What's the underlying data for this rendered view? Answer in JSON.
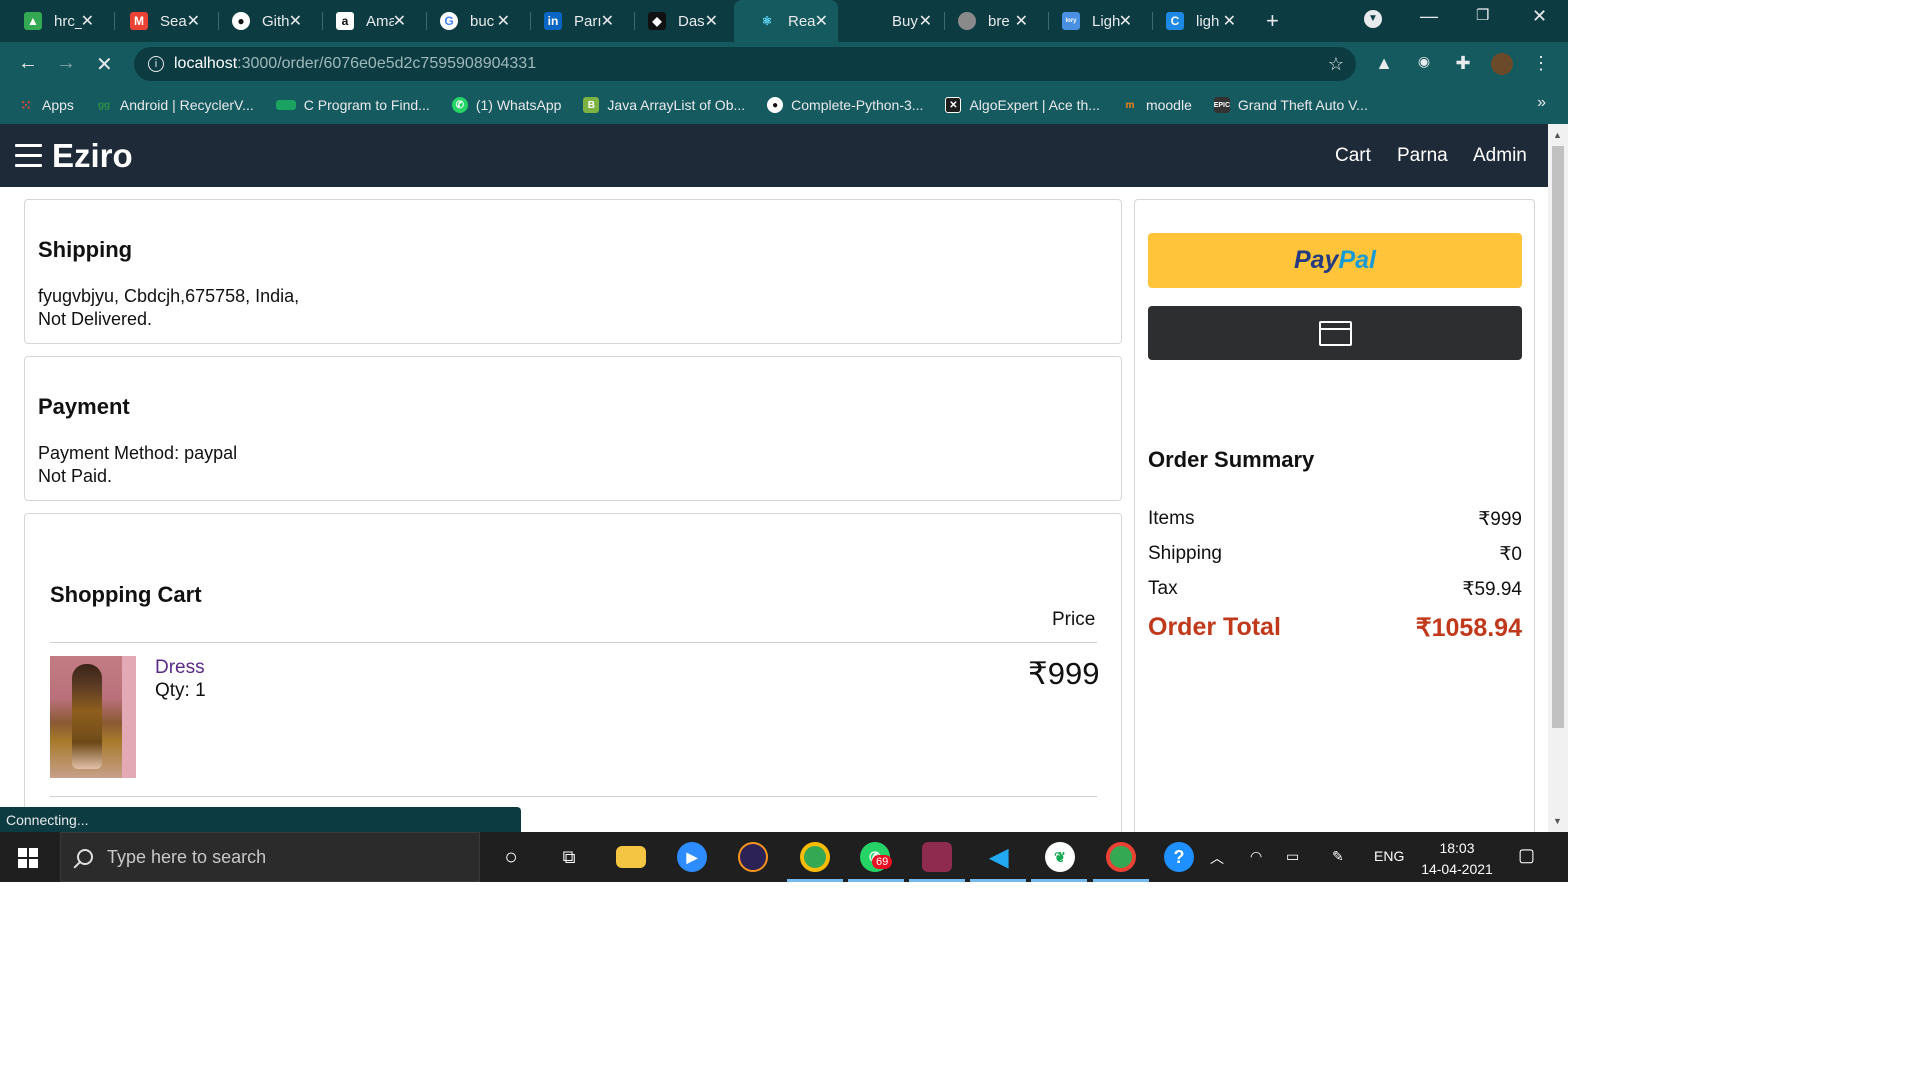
{
  "browser": {
    "tabs": [
      {
        "label": "hrc_",
        "icon": "google-drive-icon",
        "color": "#34a853"
      },
      {
        "label": "Sea",
        "icon": "gmail-icon",
        "color": "#ea4335"
      },
      {
        "label": "Gith",
        "icon": "github-icon",
        "color": "#ffffff"
      },
      {
        "label": "Ama",
        "icon": "amazon-icon",
        "color": "#ffffff"
      },
      {
        "label": "buc",
        "icon": "google-icon",
        "color": "#4285f4"
      },
      {
        "label": "Parı",
        "icon": "linkedin-icon",
        "color": "#0a66c2"
      },
      {
        "label": "Das",
        "icon": "dashboard-icon",
        "color": "#222222"
      },
      {
        "label": "Rea",
        "icon": "react-icon",
        "color": "#61dafb"
      },
      {
        "label": "Buy",
        "icon": "shop-icon",
        "color": "#0c3c42"
      },
      {
        "label": "bre",
        "icon": "globe-icon",
        "color": "#8a8a8a"
      },
      {
        "label": "Ligh",
        "icon": "colory-icon",
        "color": "#4a90e2"
      },
      {
        "label": "ligh",
        "icon": "c-icon",
        "color": "#1e88e5"
      }
    ],
    "url_host": "localhost",
    "url_path": ":3000/order/6076e0e5d2c7595908904331",
    "bookmarks": [
      {
        "label": "Apps",
        "icon": "apps-grid-icon",
        "color": "#ea4335"
      },
      {
        "label": "Android | RecyclerV...",
        "icon": "geeksforgeeks-icon",
        "color": "#2f8d46"
      },
      {
        "label": "C Program to Find...",
        "icon": "bookmark-site-icon",
        "color": "#1aa260"
      },
      {
        "label": "(1) WhatsApp",
        "icon": "whatsapp-icon",
        "color": "#25d366"
      },
      {
        "label": "Java ArrayList of Ob...",
        "icon": "java-bookmark-icon",
        "color": "#7cb342"
      },
      {
        "label": "Complete-Python-3...",
        "icon": "github-icon",
        "color": "#ffffff"
      },
      {
        "label": "AlgoExpert | Ace th...",
        "icon": "algoexpert-icon",
        "color": "#1d1d1d"
      },
      {
        "label": "moodle",
        "icon": "moodle-icon",
        "color": "#f98012"
      },
      {
        "label": "Grand Theft Auto V...",
        "icon": "epic-games-icon",
        "color": "#333333"
      }
    ]
  },
  "app": {
    "brand": "Eziro",
    "nav": {
      "cart": "Cart",
      "user": "Parna",
      "admin": "Admin"
    }
  },
  "shipping": {
    "title": "Shipping",
    "address": "fyugvbjyu, Cbdcjh,675758, India,",
    "status": "Not Delivered."
  },
  "payment": {
    "title": "Payment",
    "method": "Payment Method: paypal",
    "status": "Not Paid."
  },
  "cart": {
    "title": "Shopping Cart",
    "price_header": "Price",
    "items": [
      {
        "name": "Dress",
        "qty": "Qty: 1",
        "price": "₹999"
      }
    ]
  },
  "paypal": {
    "word1": "Pay",
    "word2": "Pal"
  },
  "summary": {
    "title": "Order Summary",
    "items_label": "Items",
    "items_value": "₹999",
    "shipping_label": "Shipping",
    "shipping_value": "₹0",
    "tax_label": "Tax",
    "tax_value": "₹59.94",
    "total_label": "Order Total",
    "total_value": "₹1058.94"
  },
  "status_bar": "Connecting...",
  "taskbar": {
    "search_placeholder": "Type here to search",
    "whatsapp_badge": "69",
    "lang": "ENG",
    "time": "18:03",
    "date": "14-04-2021"
  },
  "colors": {
    "header_bg": "#1f2a38",
    "paypal_yellow": "#ffc439",
    "total_red": "#c0391b",
    "link_purple": "#5b2a86",
    "chrome_teal": "#145a5f"
  }
}
